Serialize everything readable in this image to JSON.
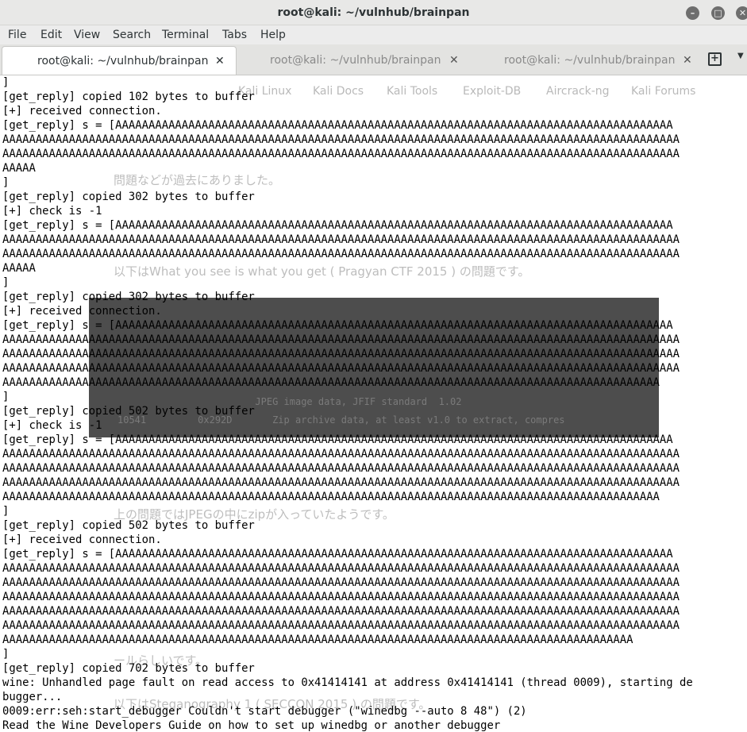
{
  "window": {
    "title": "root@kali: ~/vulnhub/brainpan",
    "minimize_icon": "minimize-icon",
    "maximize_icon": "maximize-icon",
    "close_icon": "close-icon"
  },
  "menubar": {
    "items": [
      "File",
      "Edit",
      "View",
      "Search",
      "Terminal",
      "Tabs",
      "Help"
    ]
  },
  "tabs": [
    {
      "label": "root@kali: ~/vulnhub/brainpan",
      "close": "✕",
      "active": true
    },
    {
      "label": "root@kali: ~/vulnhub/brainpan",
      "close": "✕",
      "active": false
    },
    {
      "label": "root@kali: ~/vulnhub/brainpan",
      "close": "✕",
      "active": false
    }
  ],
  "tabbar": {
    "new_tab_icon": "+",
    "menu_icon": "▼"
  },
  "background_bleed": {
    "bookmarks": [
      "Kali Linux",
      "Kali Docs",
      "Kali Tools",
      "Exploit-DB",
      "Aircrack-ng",
      "Kali Forums"
    ],
    "paragraphs": [
      "問題などが過去にありました。",
      "以下はWhat you see is what you get ( Pragyan CTF 2015 ) の問題です。",
      "上の問題ではJPEGの中にzipが入っていたようです。",
      "ールらしいです。",
      "以下はSteganography 1 ( SECCON 2015 ) の問題です。"
    ],
    "code_lines": [
      "                        JPEG image data, JFIF standard  1.02",
      "10541         0x292D       Zip archive data, at least v1.0 to extract, compres"
    ]
  },
  "terminal": {
    "lines": [
      "]",
      "[get_reply] copied 102 bytes to buffer",
      "[+] received connection.",
      "[get_reply] s = [AAAAAAAAAAAAAAAAAAAAAAAAAAAAAAAAAAAAAAAAAAAAAAAAAAAAAAAAAAAAAAAAAAAAAAAAAAAAAAAAAAAA",
      "AAAAAAAAAAAAAAAAAAAAAAAAAAAAAAAAAAAAAAAAAAAAAAAAAAAAAAAAAAAAAAAAAAAAAAAAAAAAAAAAAAAAAAAAAAAAAAAAAAAAAA",
      "AAAAAAAAAAAAAAAAAAAAAAAAAAAAAAAAAAAAAAAAAAAAAAAAAAAAAAAAAAAAAAAAAAAAAAAAAAAAAAAAAAAAAAAAAAAAAAAAAAAAAA",
      "AAAAA",
      "]",
      "[get_reply] copied 302 bytes to buffer",
      "[+] check is -1",
      "[get_reply] s = [AAAAAAAAAAAAAAAAAAAAAAAAAAAAAAAAAAAAAAAAAAAAAAAAAAAAAAAAAAAAAAAAAAAAAAAAAAAAAAAAAAAA",
      "AAAAAAAAAAAAAAAAAAAAAAAAAAAAAAAAAAAAAAAAAAAAAAAAAAAAAAAAAAAAAAAAAAAAAAAAAAAAAAAAAAAAAAAAAAAAAAAAAAAAAA",
      "AAAAAAAAAAAAAAAAAAAAAAAAAAAAAAAAAAAAAAAAAAAAAAAAAAAAAAAAAAAAAAAAAAAAAAAAAAAAAAAAAAAAAAAAAAAAAAAAAAAAAA",
      "AAAAA",
      "]",
      "[get_reply] copied 302 bytes to buffer",
      "[+] received connection.",
      "[get_reply] s = [AAAAAAAAAAAAAAAAAAAAAAAAAAAAAAAAAAAAAAAAAAAAAAAAAAAAAAAAAAAAAAAAAAAAAAAAAAAAAAAAAAAA",
      "AAAAAAAAAAAAAAAAAAAAAAAAAAAAAAAAAAAAAAAAAAAAAAAAAAAAAAAAAAAAAAAAAAAAAAAAAAAAAAAAAAAAAAAAAAAAAAAAAAAAAA",
      "AAAAAAAAAAAAAAAAAAAAAAAAAAAAAAAAAAAAAAAAAAAAAAAAAAAAAAAAAAAAAAAAAAAAAAAAAAAAAAAAAAAAAAAAAAAAAAAAAAAAAA",
      "AAAAAAAAAAAAAAAAAAAAAAAAAAAAAAAAAAAAAAAAAAAAAAAAAAAAAAAAAAAAAAAAAAAAAAAAAAAAAAAAAAAAAAAAAAAAAAAAAAAAAA",
      "AAAAAAAAAAAAAAAAAAAAAAAAAAAAAAAAAAAAAAAAAAAAAAAAAAAAAAAAAAAAAAAAAAAAAAAAAAAAAAAAAAAAAAAAAAAAAAAAAAA",
      "]",
      "[get_reply] copied 502 bytes to buffer",
      "[+] check is -1",
      "[get_reply] s = [AAAAAAAAAAAAAAAAAAAAAAAAAAAAAAAAAAAAAAAAAAAAAAAAAAAAAAAAAAAAAAAAAAAAAAAAAAAAAAAAAAAA",
      "AAAAAAAAAAAAAAAAAAAAAAAAAAAAAAAAAAAAAAAAAAAAAAAAAAAAAAAAAAAAAAAAAAAAAAAAAAAAAAAAAAAAAAAAAAAAAAAAAAAAAA",
      "AAAAAAAAAAAAAAAAAAAAAAAAAAAAAAAAAAAAAAAAAAAAAAAAAAAAAAAAAAAAAAAAAAAAAAAAAAAAAAAAAAAAAAAAAAAAAAAAAAAAAA",
      "AAAAAAAAAAAAAAAAAAAAAAAAAAAAAAAAAAAAAAAAAAAAAAAAAAAAAAAAAAAAAAAAAAAAAAAAAAAAAAAAAAAAAAAAAAAAAAAAAAAAAA",
      "AAAAAAAAAAAAAAAAAAAAAAAAAAAAAAAAAAAAAAAAAAAAAAAAAAAAAAAAAAAAAAAAAAAAAAAAAAAAAAAAAAAAAAAAAAAAAAAAAAA",
      "]",
      "[get_reply] copied 502 bytes to buffer",
      "[+] received connection.",
      "[get_reply] s = [AAAAAAAAAAAAAAAAAAAAAAAAAAAAAAAAAAAAAAAAAAAAAAAAAAAAAAAAAAAAAAAAAAAAAAAAAAAAAAAAAAAA",
      "AAAAAAAAAAAAAAAAAAAAAAAAAAAAAAAAAAAAAAAAAAAAAAAAAAAAAAAAAAAAAAAAAAAAAAAAAAAAAAAAAAAAAAAAAAAAAAAAAAAAAA",
      "AAAAAAAAAAAAAAAAAAAAAAAAAAAAAAAAAAAAAAAAAAAAAAAAAAAAAAAAAAAAAAAAAAAAAAAAAAAAAAAAAAAAAAAAAAAAAAAAAAAAAA",
      "AAAAAAAAAAAAAAAAAAAAAAAAAAAAAAAAAAAAAAAAAAAAAAAAAAAAAAAAAAAAAAAAAAAAAAAAAAAAAAAAAAAAAAAAAAAAAAAAAAAAAA",
      "AAAAAAAAAAAAAAAAAAAAAAAAAAAAAAAAAAAAAAAAAAAAAAAAAAAAAAAAAAAAAAAAAAAAAAAAAAAAAAAAAAAAAAAAAAAAAAAAAAAAAA",
      "AAAAAAAAAAAAAAAAAAAAAAAAAAAAAAAAAAAAAAAAAAAAAAAAAAAAAAAAAAAAAAAAAAAAAAAAAAAAAAAAAAAAAAAAAAAAAAAAAAAAAA",
      "AAAAAAAAAAAAAAAAAAAAAAAAAAAAAAAAAAAAAAAAAAAAAAAAAAAAAAAAAAAAAAAAAAAAAAAAAAAAAAAAAAAAAAAAAAAAAAA",
      "]",
      "[get_reply] copied 702 bytes to buffer",
      "wine: Unhandled page fault on read access to 0x41414141 at address 0x41414141 (thread 0009), starting de",
      "bugger...",
      "0009:err:seh:start_debugger Couldn't start debugger (\"winedbg --auto 8 48\") (2)",
      "Read the Wine Developers Guide on how to set up winedbg or another debugger"
    ]
  }
}
